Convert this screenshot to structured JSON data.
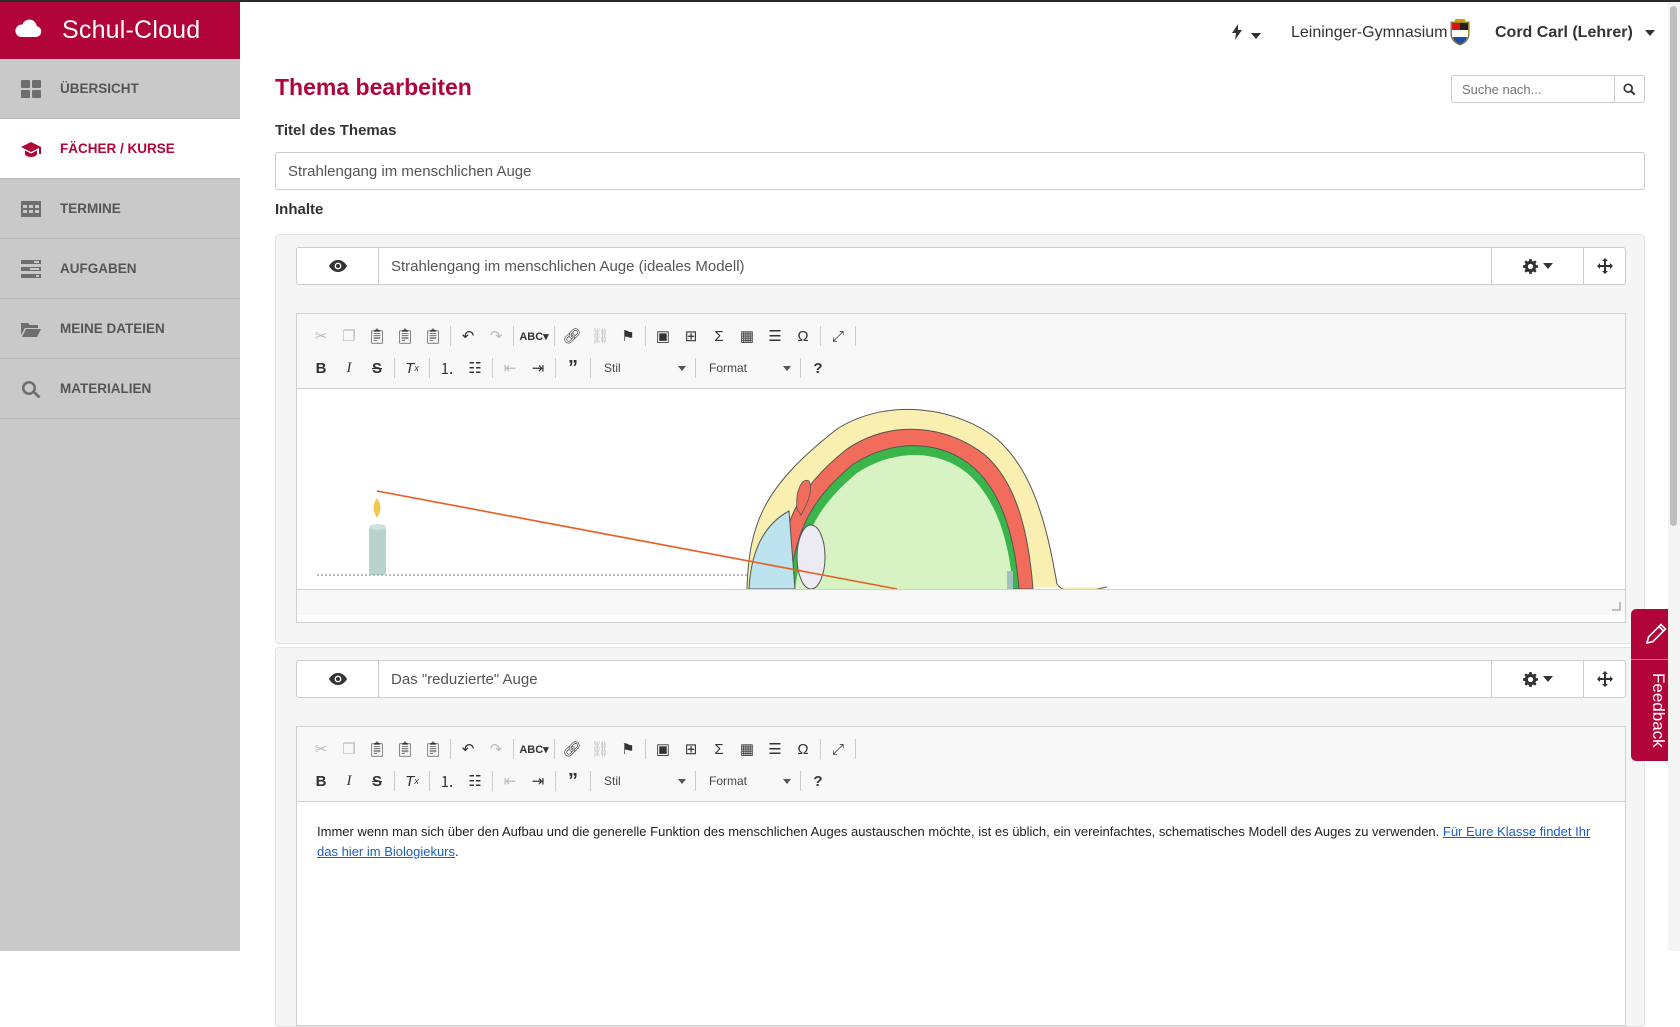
{
  "app": {
    "title": "Schul-Cloud"
  },
  "sidebar": {
    "items": [
      {
        "label": "Übersicht",
        "icon": "dashboard-icon"
      },
      {
        "label": "Fächer / Kurse",
        "icon": "graduation-cap-icon"
      },
      {
        "label": "Termine",
        "icon": "calendar-table-icon"
      },
      {
        "label": "Aufgaben",
        "icon": "tasks-icon"
      },
      {
        "label": "Meine Dateien",
        "icon": "folder-open-icon"
      },
      {
        "label": "Materialien",
        "icon": "search-icon"
      }
    ],
    "active_index": 1
  },
  "topbar": {
    "quick_menu_icon": "bolt-icon",
    "school": "Leininger-Gymnasium",
    "user": "Cord Carl (Lehrer)"
  },
  "search": {
    "placeholder": "Suche nach..."
  },
  "page": {
    "title": "Thema bearbeiten",
    "topic_title_label": "Titel des Themas",
    "topic_title_value": "Strahlengang im menschlichen Auge",
    "contents_label": "Inhalte"
  },
  "editor_toolbar": {
    "style_label": "Stil",
    "format_label": "Format"
  },
  "blocks": [
    {
      "title": "Strahlengang im menschlichen Auge (ideales Modell)",
      "content_type": "image"
    },
    {
      "title": "Das \"reduzierte\" Auge",
      "content_type": "text",
      "text": "Immer wenn man sich über den Aufbau und die generelle Funktion des menschlichen Auges austauschen möchte, ist es üblich, ein vereinfachtes, schematisches Modell des Auges zu verwenden. ",
      "link_text": "Für Eure Klasse findet Ihr das hier im Biologiekurs",
      "text_end": "."
    }
  ],
  "feedback": {
    "label": "Feedback"
  },
  "colors": {
    "brand": "#b10438",
    "sidebar": "#c9c9c9",
    "link": "#1a5fc4"
  }
}
